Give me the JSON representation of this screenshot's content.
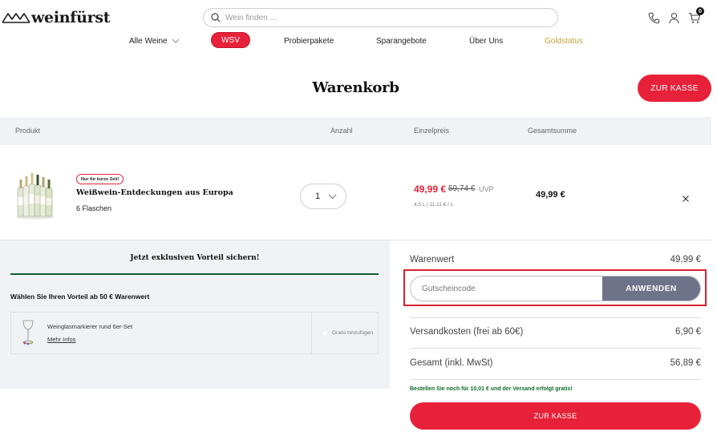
{
  "header": {
    "logo_text": "weinfürst",
    "search_placeholder": "Wein finden ...",
    "cart_count": "0"
  },
  "nav": {
    "items": [
      "Alle Weine",
      "WSV",
      "Probierpakete",
      "Sparangebote",
      "Über Uns",
      "Goldstatus"
    ]
  },
  "page": {
    "title": "Warenkorb",
    "checkout_top": "ZUR KASSE"
  },
  "table": {
    "headers": [
      "Produkt",
      "Anzahl",
      "Einzelpreis",
      "Gesamtsumme"
    ]
  },
  "item": {
    "badge": "Nur für kurze Zeit!",
    "name": "Weißwein-Entdeckungen aus Europa",
    "subtitle": "6 Flaschen",
    "quantity": "1",
    "price_now": "49,99 €",
    "price_old": "59,74 €",
    "uvp": "UVP",
    "unit_info": "4,5 L | 11,11 € / L",
    "total": "49,99 €"
  },
  "advantage": {
    "title": "Jetzt exklusiven Vorteil sichern!",
    "subtitle": "Wählen Sie Ihren Vorteil ab 50 € Warenwert",
    "offer_name": "Weinglasmarkierer rund 6er-Set",
    "offer_link": "Mehr Infos",
    "offer_add": "Gratis hinzufügen"
  },
  "summary": {
    "warenwert_label": "Warenwert",
    "warenwert_value": "49,99 €",
    "coupon_placeholder": "Gutscheincode",
    "coupon_button": "ANWENDEN",
    "shipping_label": "Versandkosten (frei ab 60€)",
    "shipping_value": "6,90 €",
    "total_label": "Gesamt (inkl. MwSt)",
    "total_value": "56,89 €",
    "shipping_note": "Bestellen Sie noch für 10,01 € und der Versand erfolgt gratis!",
    "checkout_bottom": "ZUR KASSE"
  },
  "colors": {
    "brand_red": "#e8213a",
    "gold": "#c8a23b",
    "green": "#145a32",
    "button_grey": "#6f7389",
    "highlight": "#d92032"
  }
}
